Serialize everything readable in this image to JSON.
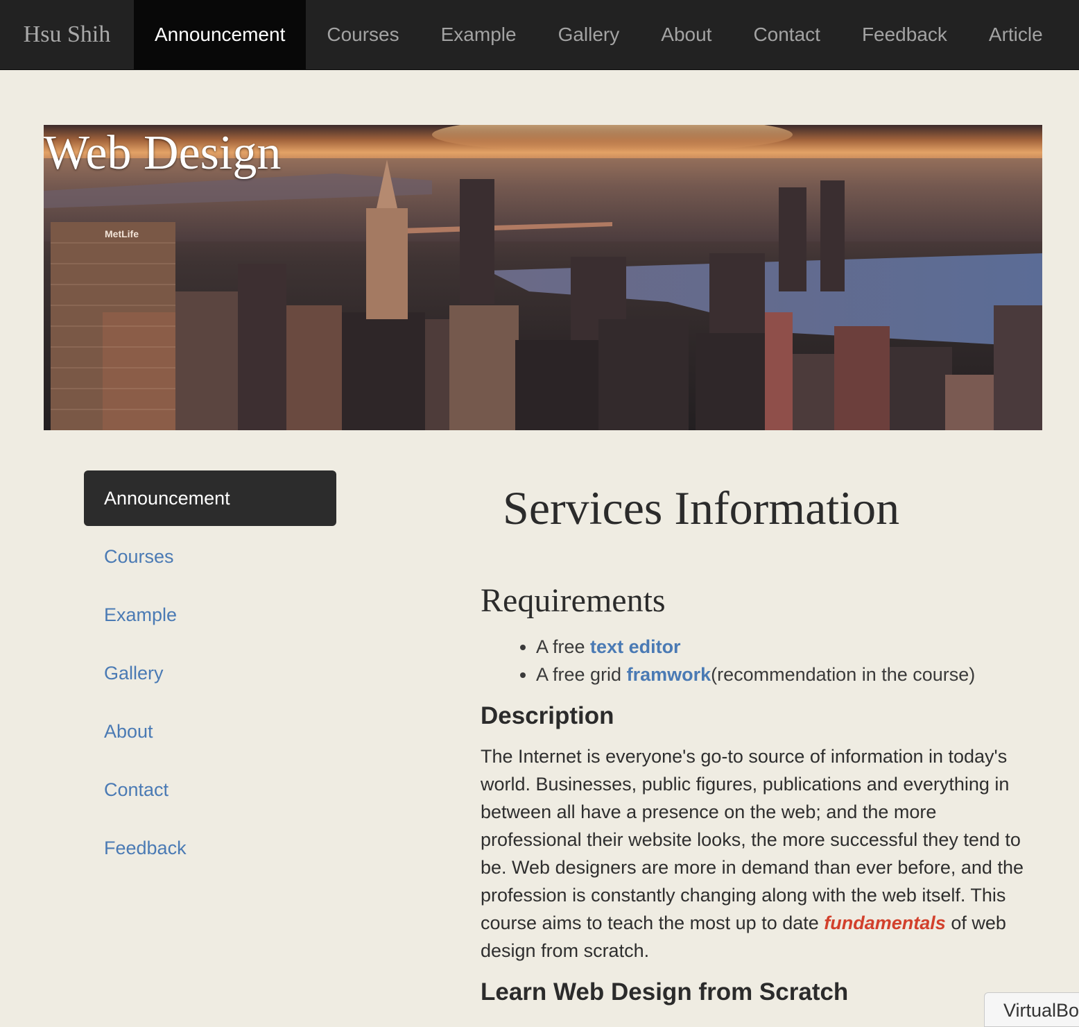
{
  "navbar": {
    "brand": "Hsu Shih",
    "items": [
      {
        "label": "Announcement",
        "active": true
      },
      {
        "label": "Courses"
      },
      {
        "label": "Example"
      },
      {
        "label": "Gallery"
      },
      {
        "label": "About"
      },
      {
        "label": "Contact"
      },
      {
        "label": "Feedback"
      },
      {
        "label": "Article"
      }
    ]
  },
  "hero": {
    "title": "Web Design",
    "sign_text": "MetLife"
  },
  "sidenav": {
    "items": [
      {
        "label": "Announcement",
        "active": true
      },
      {
        "label": "Courses"
      },
      {
        "label": "Example"
      },
      {
        "label": "Gallery"
      },
      {
        "label": "About"
      },
      {
        "label": "Contact"
      },
      {
        "label": "Feedback"
      }
    ]
  },
  "content": {
    "title": "Services Information",
    "requirements": {
      "heading": "Requirements",
      "items": [
        {
          "prefix": "A free ",
          "link": "text editor",
          "suffix": ""
        },
        {
          "prefix": "A free grid ",
          "link": "framwork",
          "suffix": "(recommendation in the course)"
        }
      ]
    },
    "description": {
      "heading": "Description",
      "text_before": "The Internet is everyone's go-to source of information in today's world. Businesses, public figures, publications and everything in between all have a presence on the web; and the more professional their website looks, the more successful they tend to be. Web designers are more in demand than ever before, and the profession is constantly changing along with the web itself. This course aims to teach the most up to date ",
      "highlight": "fundamentals",
      "text_after": " of web design from scratch."
    },
    "learn_heading": "Learn Web Design from Scratch"
  },
  "overlay": {
    "label": "VirtualBox"
  },
  "colors": {
    "background": "#efece2",
    "navbar": "#222222",
    "navbar_active": "#080808",
    "link": "#4a7ab4",
    "highlight": "#d2402c",
    "side_active": "#2c2c2c"
  }
}
